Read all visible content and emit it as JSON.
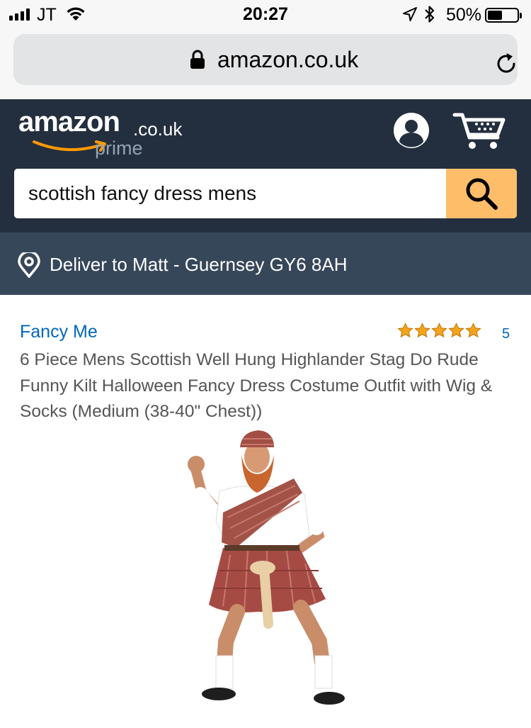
{
  "status_bar": {
    "carrier": "JT",
    "time": "20:27",
    "battery_percent": "50%",
    "battery_level": 0.5
  },
  "browser": {
    "url": "amazon.co.uk"
  },
  "header": {
    "logo_text": "amazon",
    "logo_domain": ".co.uk",
    "logo_sub": "prime",
    "colors": {
      "header_bg": "#232f3e",
      "search_button": "#febd69",
      "deliver_bg": "#37475a",
      "link": "#0066c0",
      "star": "#f4a41c"
    }
  },
  "search": {
    "value": "scottish fancy dress mens"
  },
  "delivery": {
    "text": "Deliver to Matt - Guernsey GY6 8AH"
  },
  "product": {
    "brand": "Fancy Me",
    "rating_stars": 5,
    "rating_count": "5",
    "title": "6 Piece Mens Scottish Well Hung Highlander Stag Do Rude Funny Kilt Halloween Fancy Dress Costume Outfit with Wig & Socks (Medium (38-40\" Chest))"
  }
}
